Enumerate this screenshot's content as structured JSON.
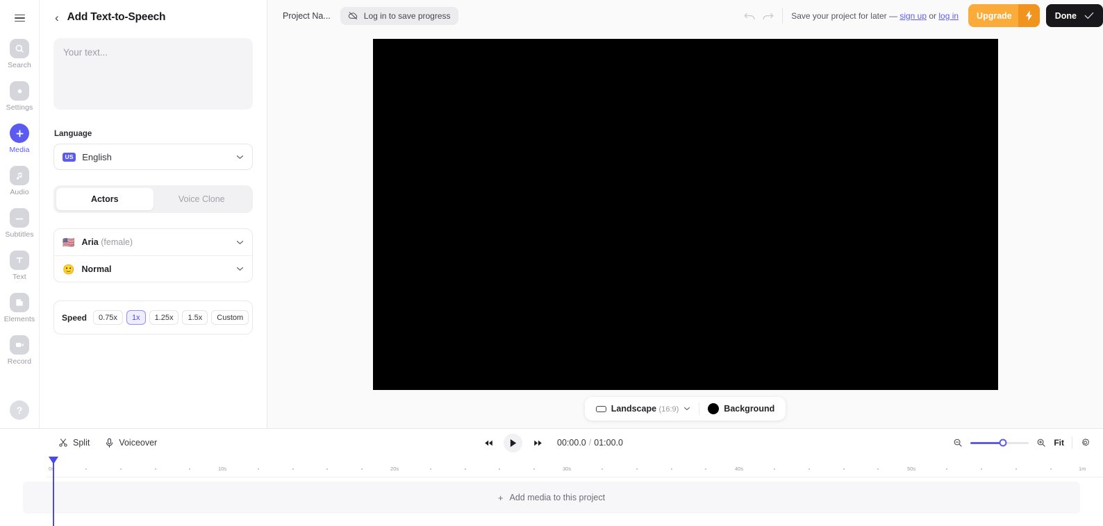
{
  "sidebar": {
    "menu_icon": "hamburger-icon",
    "items": [
      {
        "label": "Search",
        "icon": "search-icon",
        "active": false
      },
      {
        "label": "Settings",
        "icon": "gear-icon",
        "active": false
      },
      {
        "label": "Media",
        "icon": "plus-icon",
        "active": true
      },
      {
        "label": "Audio",
        "icon": "music-note-icon",
        "active": false
      },
      {
        "label": "Subtitles",
        "icon": "subtitles-icon",
        "active": false
      },
      {
        "label": "Text",
        "icon": "text-t-icon",
        "active": false
      },
      {
        "label": "Elements",
        "icon": "shapes-icon",
        "active": false
      },
      {
        "label": "Record",
        "icon": "video-camera-icon",
        "active": false
      }
    ],
    "help_label": "?",
    "active_color": "#5b5bf0"
  },
  "panel": {
    "back_label": "‹",
    "title": "Add Text-to-Speech",
    "text_value": "",
    "text_placeholder": "Your text...",
    "language_label": "Language",
    "language_badge": "US",
    "language_value": "English",
    "tabs": [
      {
        "label": "Actors",
        "active": true
      },
      {
        "label": "Voice Clone",
        "active": false
      }
    ],
    "voice": {
      "emoji": "🇺🇸",
      "name": "Aria",
      "suffix": "(female)"
    },
    "style": {
      "emoji": "🙂",
      "name": "Normal"
    },
    "speed_label": "Speed",
    "speed_options": [
      {
        "label": "0.75x",
        "active": false
      },
      {
        "label": "1x",
        "active": true
      },
      {
        "label": "1.25x",
        "active": false
      },
      {
        "label": "1.5x",
        "active": false
      },
      {
        "label": "Custom",
        "active": false
      }
    ]
  },
  "topbar": {
    "project_name": "Project Na...",
    "login_pill_label": "Log in to save progress",
    "login_pill_icon": "cloud-off-icon",
    "undo_icon": "undo-arrow-icon",
    "redo_icon": "redo-arrow-icon",
    "save_note_prefix": "Save your project for later — ",
    "save_note_signup": "sign up",
    "save_note_mid": " or ",
    "save_note_login": "log in",
    "upgrade_label": "Upgrade",
    "upgrade_icon": "lightning-bolt-icon",
    "upgrade_color": "#fbab3a",
    "done_label": "Done",
    "done_icon": "checkmark-icon",
    "done_color": "#18181c"
  },
  "canvas": {
    "background_color": "#000000",
    "aspect_label": "Landscape",
    "aspect_ratio": "(16:9)",
    "background_label": "Background",
    "background_swatch": "#000000"
  },
  "timeline": {
    "split_label": "Split",
    "split_icon": "scissors-icon",
    "voiceover_label": "Voiceover",
    "voiceover_icon": "microphone-icon",
    "skip_back_icon": "skip-back-icon",
    "play_icon": "play-icon",
    "skip_forward_icon": "skip-forward-icon",
    "current_time": "00:00.0",
    "separator": "/",
    "total_time": "01:00.0",
    "zoom_out_icon": "zoom-out-icon",
    "zoom_in_icon": "zoom-in-icon",
    "zoom_value": 55,
    "fit_label": "Fit",
    "settings_icon": "gear-icon",
    "ruler_ticks": [
      "0s",
      "10s",
      "20s",
      "30s",
      "40s",
      "50s",
      "1m"
    ],
    "add_media_label": "Add media to this project",
    "add_media_icon": "plus-icon"
  }
}
